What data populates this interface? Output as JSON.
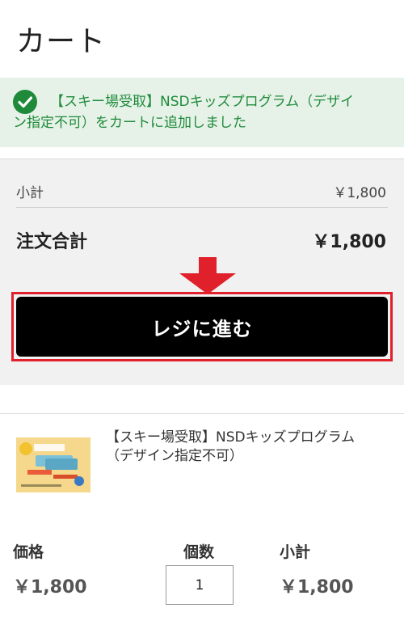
{
  "page": {
    "title": "カート"
  },
  "notice": {
    "line1": "【スキー場受取】NSDキッズプログラム（デザイ",
    "line2": "ン指定不可）をカートに追加しました",
    "icon": "check-circle-icon",
    "color": "#1f8a3a",
    "background": "#e6f2e8"
  },
  "summary": {
    "subtotal_label": "小計",
    "subtotal_value": "￥1,800",
    "total_label": "注文合計",
    "total_value": "￥1,800"
  },
  "checkout": {
    "label": "レジに進む",
    "arrow_icon": "down-arrow-icon",
    "highlight_color": "#e0202a"
  },
  "item": {
    "name_line1": "【スキー場受取】NSDキッズプログラム",
    "name_line2": "（デザイン指定不可）",
    "price_label": "価格",
    "price_value": "￥1,800",
    "qty_label": "個数",
    "qty_value": "1",
    "subtotal_label": "小計",
    "subtotal_value": "￥1,800"
  }
}
